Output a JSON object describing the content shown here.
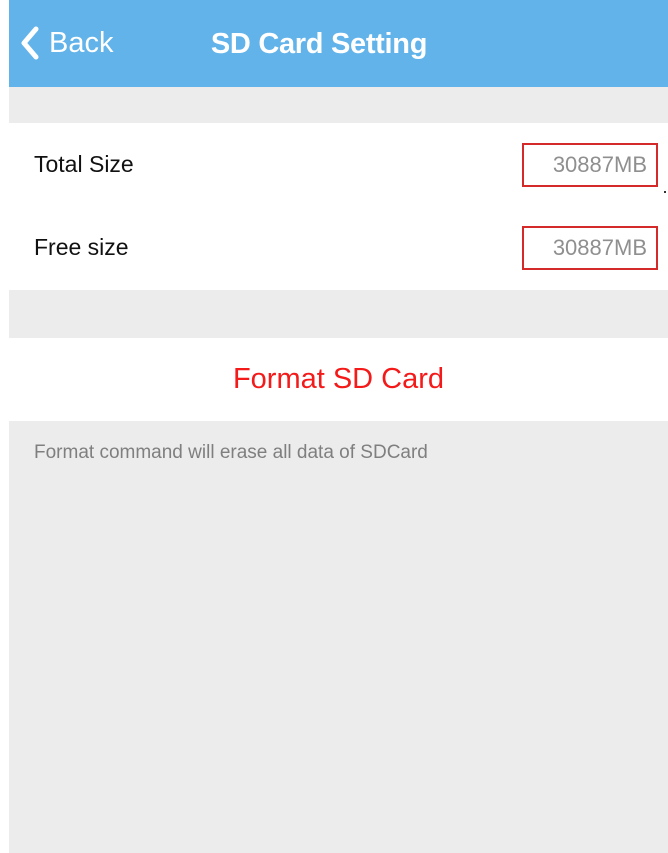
{
  "navbar": {
    "back_label": "Back",
    "title": "SD Card Setting",
    "background_color": "#62b3ea",
    "back_icon": "chevron-left-icon"
  },
  "storage": {
    "rows": [
      {
        "label": "Total Size",
        "value": "30887MB"
      },
      {
        "label": "Free size",
        "value": "30887MB"
      }
    ],
    "highlight_color": "#d42a2a"
  },
  "actions": {
    "format_label": "Format SD Card",
    "format_color": "#f41a1a"
  },
  "footnote": "Format command will erase all data of SDCard"
}
